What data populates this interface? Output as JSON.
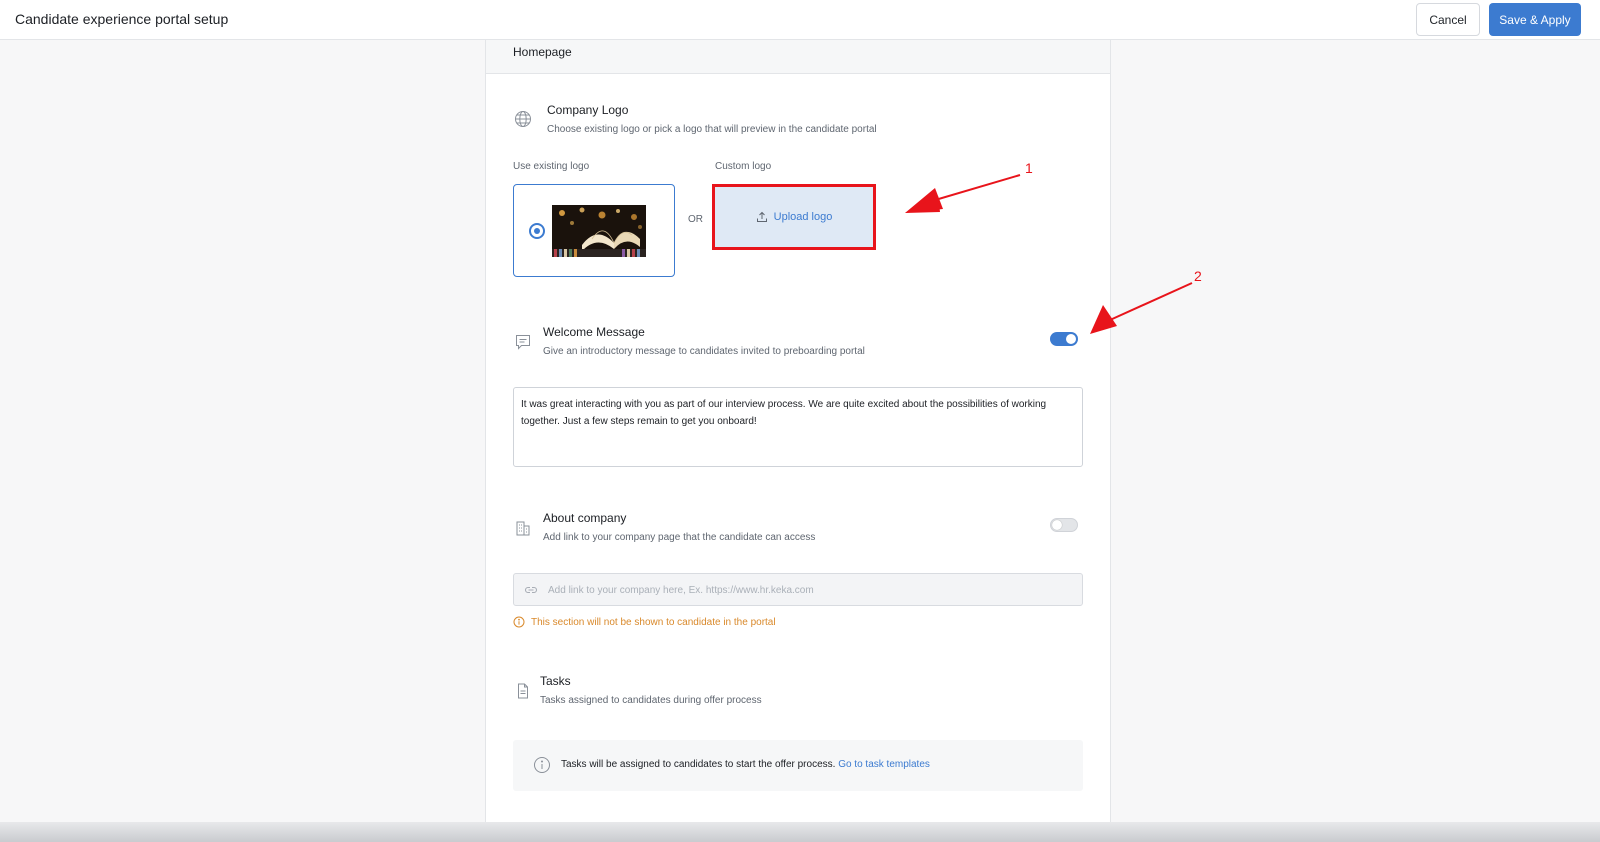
{
  "header": {
    "title": "Candidate experience portal setup",
    "cancel_label": "Cancel",
    "save_label": "Save & Apply"
  },
  "panel": {
    "heading": "Homepage"
  },
  "company_logo": {
    "title": "Company Logo",
    "subtitle": "Choose existing logo or pick a logo that will preview in the candidate portal",
    "existing_label": "Use existing logo",
    "custom_label": "Custom logo",
    "or_text": "OR",
    "upload_label": "Upload logo",
    "selected": "existing"
  },
  "welcome_message": {
    "title": "Welcome Message",
    "subtitle": "Give an introductory message to candidates invited to preboarding portal",
    "enabled": true,
    "text": "It was great interacting with you as part of our interview process. We are quite excited about the possibilities of working together. Just a few steps remain to get you onboard!"
  },
  "about_company": {
    "title": "About company",
    "subtitle": "Add link to your company page that the candidate can access",
    "enabled": false,
    "placeholder": "Add link to your company here, Ex. https://www.hr.keka.com",
    "value": "",
    "warning": "This section will not be shown to candidate in the portal"
  },
  "tasks": {
    "title": "Tasks",
    "subtitle": "Tasks assigned to candidates during offer process",
    "info_text": "Tasks will be assigned to candidates to start the offer process.",
    "link_text": "Go to task templates"
  },
  "annotations": {
    "marker_1": "1",
    "marker_2": "2"
  },
  "icons": {
    "company_logo": "globe-icon",
    "welcome_message": "message-icon",
    "about_company": "building-icon",
    "tasks": "document-icon",
    "upload": "upload-icon",
    "link": "link-icon",
    "warning": "info-circle-icon"
  },
  "colors": {
    "accent": "#3c7bd0",
    "highlight": "#e8141b",
    "warning": "#d9892b"
  }
}
